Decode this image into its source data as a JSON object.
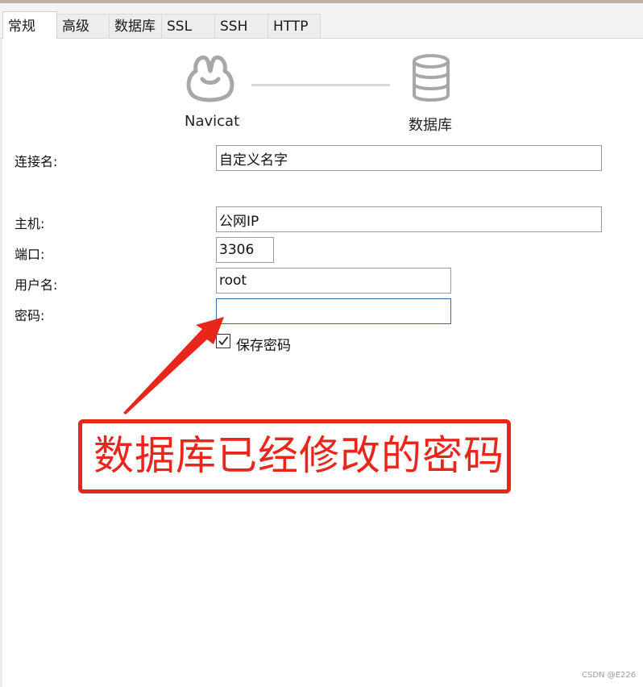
{
  "tabs": [
    "常规",
    "高级",
    "数据库",
    "SSL",
    "SSH",
    "HTTP"
  ],
  "active_tab": "常规",
  "header": {
    "left_label": "Navicat",
    "right_label": "数据库"
  },
  "form": {
    "connection_name": {
      "label": "连接名:",
      "value": "自定义名字"
    },
    "host": {
      "label": "主机:",
      "value": "公网IP"
    },
    "port": {
      "label": "端口:",
      "value": "3306"
    },
    "username": {
      "label": "用户名:",
      "value": "root"
    },
    "password": {
      "label": "密码:",
      "value": ""
    },
    "save_password": {
      "label": "保存密码",
      "checked": true
    }
  },
  "annotation": {
    "text": "数据库已经修改的密码",
    "color": "#e8261c"
  },
  "watermark": "CSDN @E226"
}
